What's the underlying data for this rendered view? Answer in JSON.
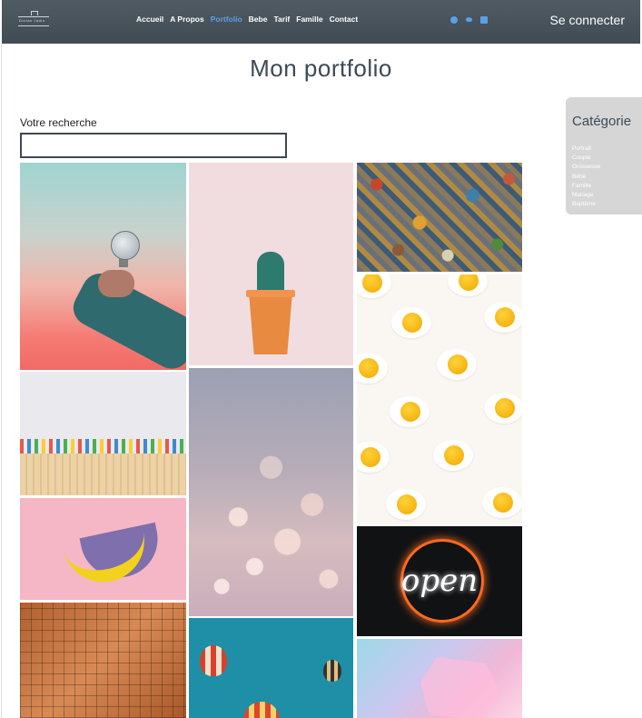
{
  "nav": {
    "logo_text": "Dorian Jadin",
    "links": [
      {
        "label": "Accueil",
        "active": false
      },
      {
        "label": "A Propos",
        "active": false
      },
      {
        "label": "Portfolio",
        "active": true
      },
      {
        "label": "Bebe",
        "active": false
      },
      {
        "label": "Tarif",
        "active": false
      },
      {
        "label": "Famille",
        "active": false
      },
      {
        "label": "Contact",
        "active": false
      }
    ],
    "socials": [
      "facebook-icon",
      "twitter-icon",
      "linkedin-icon"
    ],
    "login_label": "Se connecter",
    "active_color": "#5aa0e6",
    "background": "#4a545c"
  },
  "page": {
    "title": "Mon portfolio",
    "search_label": "Votre recherche",
    "search_value": ""
  },
  "category": {
    "title": "Catégorie",
    "items": [
      "Portrait",
      "Couple",
      "Grossesse",
      "Bébé",
      "Famille",
      "Mariage",
      "Baptême"
    ],
    "panel_color": "#d6d6d6"
  },
  "gallery": {
    "photos": [
      {
        "name": "lightbulb-photo"
      },
      {
        "name": "cactus-photo"
      },
      {
        "name": "puzzle-photo"
      },
      {
        "name": "eggs-photo"
      },
      {
        "name": "pencils-photo"
      },
      {
        "name": "bokeh-photo"
      },
      {
        "name": "banana-photo"
      },
      {
        "name": "open-neon-photo",
        "text": "open"
      },
      {
        "name": "texture-photo"
      },
      {
        "name": "balloons-photo"
      },
      {
        "name": "crystal-photo"
      }
    ]
  }
}
